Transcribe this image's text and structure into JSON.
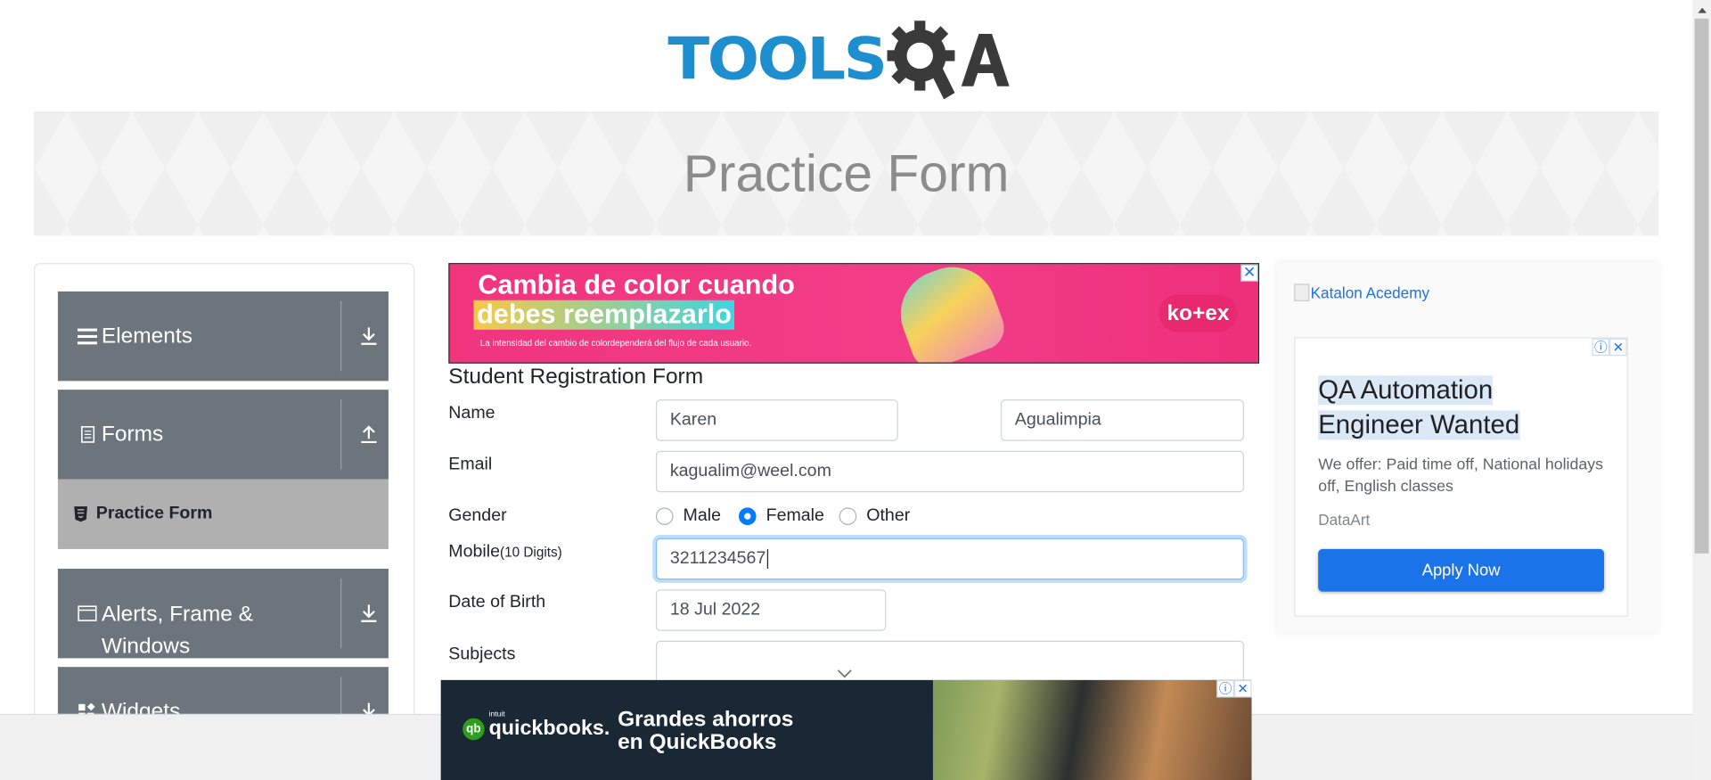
{
  "header": {
    "logo_tools": "TOOLS",
    "logo_qa": "QA"
  },
  "banner": {
    "title": "Practice Form"
  },
  "sidebar": {
    "groups": [
      {
        "label": "Elements",
        "icon": "hamburger-icon",
        "state": "collapsed"
      },
      {
        "label": "Forms",
        "icon": "document-icon",
        "state": "expanded"
      },
      {
        "label": "Alerts, Frame & Windows",
        "label_line1": "Alerts, Frame &",
        "label_line2": "Windows",
        "icon": "window-icon",
        "state": "collapsed"
      },
      {
        "label": "Widgets",
        "icon": "widgets-icon",
        "state": "collapsed"
      }
    ],
    "sub_items": [
      {
        "label": "Practice Form",
        "icon": "html5-icon",
        "active": true
      }
    ]
  },
  "ad_top": {
    "line1": "Cambia de color cuando",
    "line2": "debes reemplazarlo",
    "fine_print": "La intensidad del cambio de colordependerá del flujo de cada usuario.",
    "brand": "ko+ex"
  },
  "form": {
    "title": "Student Registration Form",
    "name_label": "Name",
    "first_name": "Karen",
    "last_name": "Agualimpia",
    "email_label": "Email",
    "email": "kagualim@weel.com",
    "gender_label": "Gender",
    "gender_options": [
      "Male",
      "Female",
      "Other"
    ],
    "gender_selected": "Female",
    "mobile_label": "Mobile",
    "mobile_hint": "(10 Digits)",
    "mobile": "3211234567",
    "dob_label": "Date of Birth",
    "dob": "18 Jul 2022",
    "subjects_label": "Subjects",
    "subjects": ""
  },
  "right_ad": {
    "image_alt": "Katalon Acedemy",
    "headline": "QA Automation Engineer Wanted",
    "description": "We offer: Paid time off, National holidays off, English classes",
    "advertiser": "DataArt",
    "cta": "Apply Now"
  },
  "ad_bottom": {
    "brand_prefix": "intuit",
    "brand": "quickbooks.",
    "line1": "Grandes ahorros",
    "line2": "en QuickBooks"
  },
  "colors": {
    "accent": "#1f8ecf",
    "sidebar": "#6c757d",
    "active_sub": "#b0b0b0",
    "primary": "#007bff",
    "ad_cta": "#1a73e8"
  }
}
